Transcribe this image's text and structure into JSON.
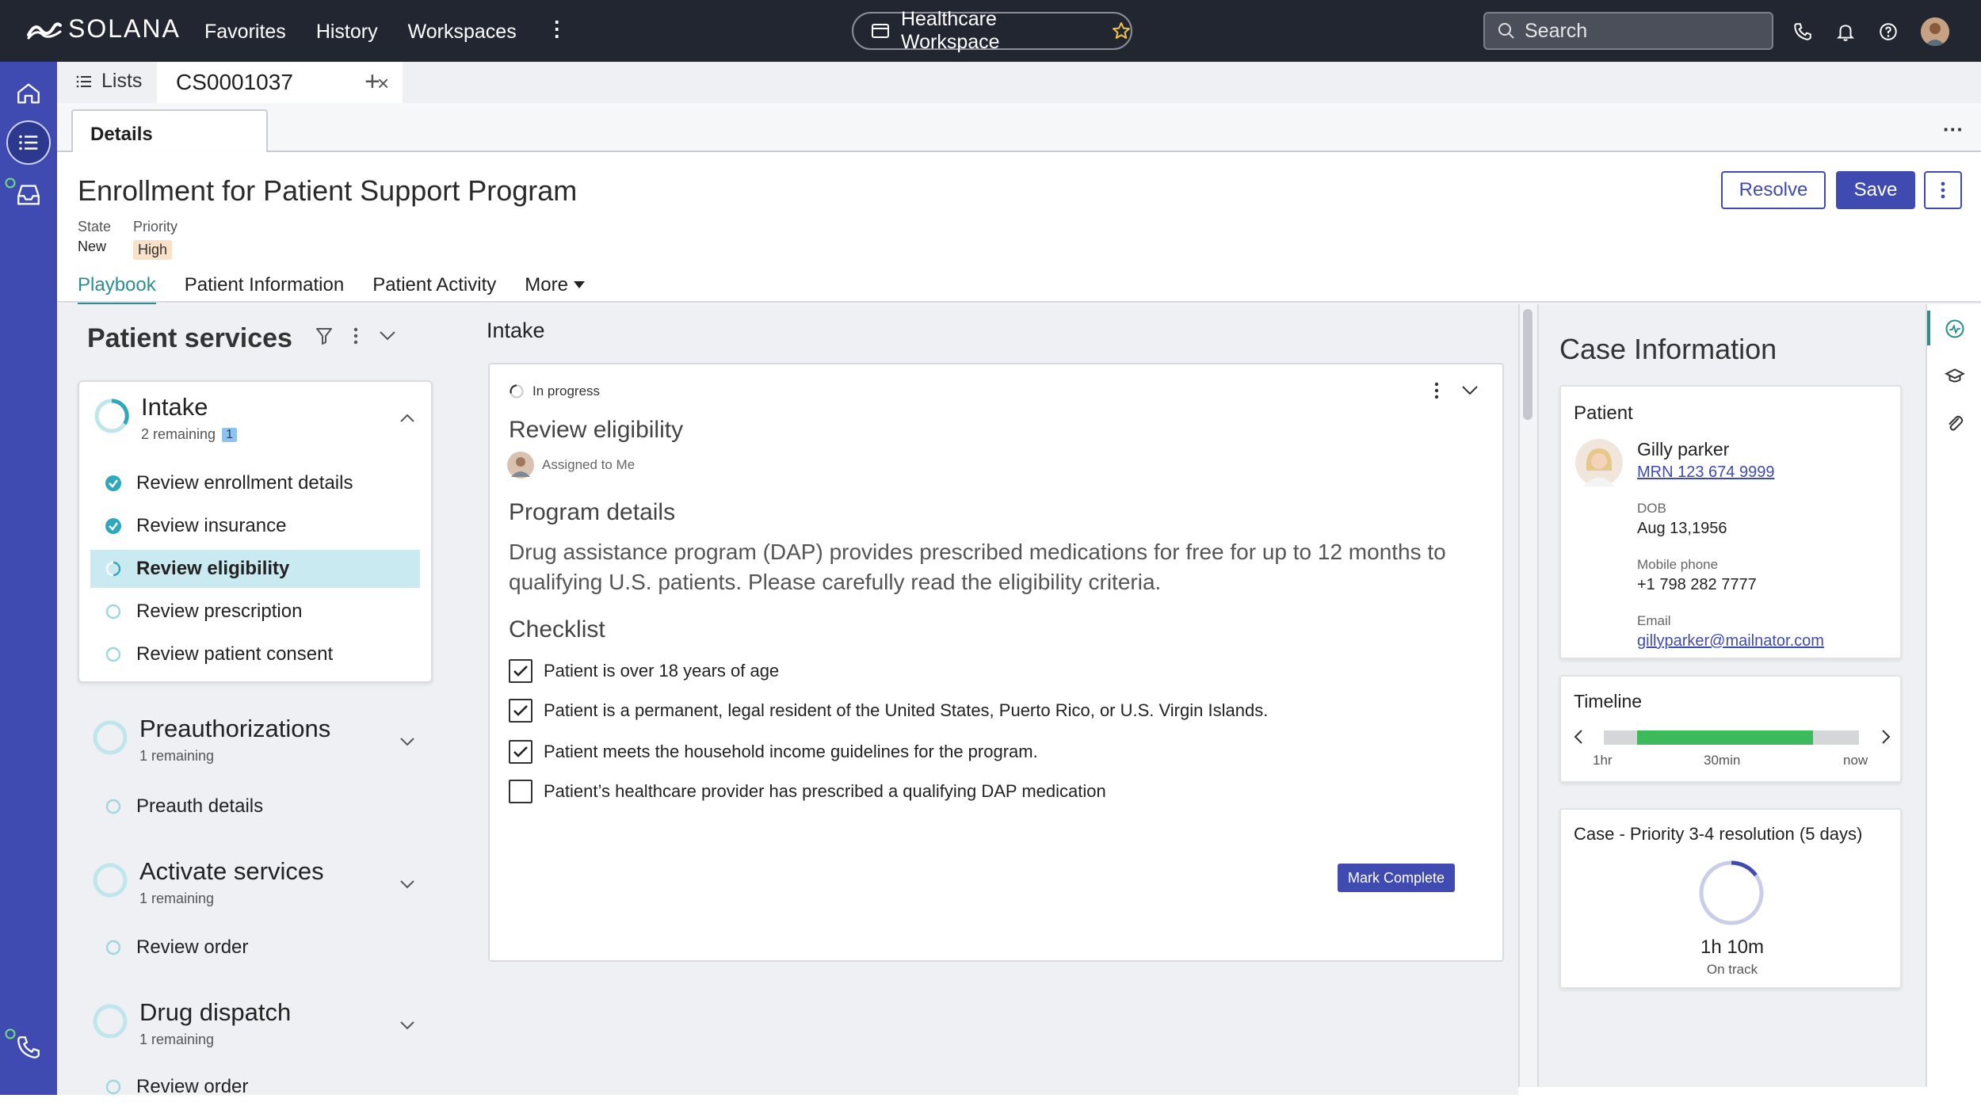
{
  "topbar": {
    "brand": "SOLANA",
    "nav": [
      "Favorites",
      "History",
      "Workspaces"
    ],
    "workspace": "Healthcare Workspace",
    "search_placeholder": "Search"
  },
  "tabs": {
    "lists_label": "Lists",
    "case_tab": "CS0001037",
    "details_tab": "Details"
  },
  "case": {
    "title": "Enrollment for Patient Support Program",
    "state_label": "State",
    "state_value": "New",
    "priority_label": "Priority",
    "priority_value": "High",
    "resolve_label": "Resolve",
    "save_label": "Save",
    "tabs": [
      "Playbook",
      "Patient Information",
      "Patient Activity",
      "More"
    ]
  },
  "playbook": {
    "title": "Patient services",
    "stages": [
      {
        "name": "Intake",
        "remaining": "2 remaining",
        "badge": "1",
        "steps": [
          "Review enrollment details",
          "Review insurance",
          "Review eligibility",
          "Review prescription",
          "Review patient consent"
        ]
      },
      {
        "name": "Preauthorizations",
        "remaining": "1 remaining",
        "steps": [
          "Preauth details"
        ]
      },
      {
        "name": "Activate services",
        "remaining": "1 remaining",
        "steps": [
          "Review order"
        ]
      },
      {
        "name": "Drug dispatch",
        "remaining": "1 remaining",
        "steps": [
          "Review order"
        ]
      }
    ]
  },
  "step": {
    "section_title": "Intake",
    "status": "In progress",
    "title": "Review eligibility",
    "assigned": "Assigned to Me",
    "program_title": "Program details",
    "program_text": "Drug assistance program (DAP) provides prescribed  medications for free for up to 12 months to qualifying U.S. patients. Please carefully read the eligibility criteria.",
    "checklist_title": "Checklist",
    "checklist": [
      {
        "text": "Patient is  over 18 years of age",
        "checked": true
      },
      {
        "text": "Patient is a permanent, legal resident of the United States, Puerto Rico, or U.S. Virgin Islands.",
        "checked": true
      },
      {
        "text": "Patient  meets the household income guidelines for the program.",
        "checked": true
      },
      {
        "text": "Patient’s healthcare provider has prescribed a qualifying DAP medication",
        "checked": false
      }
    ],
    "mark_complete": "Mark Complete"
  },
  "case_info": {
    "title": "Case Information",
    "patient_label": "Patient",
    "patient_name": "Gilly parker",
    "mrn": "MRN 123 674  9999",
    "dob_label": "DOB",
    "dob": "Aug 13,1956",
    "phone_label": "Mobile phone",
    "phone": "+1 798 282 7777",
    "email_label": "Email",
    "email": "gillyparker@mailnator.com",
    "timeline_label": "Timeline",
    "timeline_ticks": [
      "1hr",
      "30min",
      "now"
    ],
    "sla_title": "Case - Priority 3-4 resolution (5 days)",
    "sla_time": "1h 10m",
    "sla_status": "On track",
    "sla_progress": 0.15
  },
  "colors": {
    "topbar": "#212631",
    "rail": "#3f4bb1",
    "primary": "#3f4bb1",
    "teal": "#2e8d8e",
    "progress_green": "#3dba5c"
  }
}
